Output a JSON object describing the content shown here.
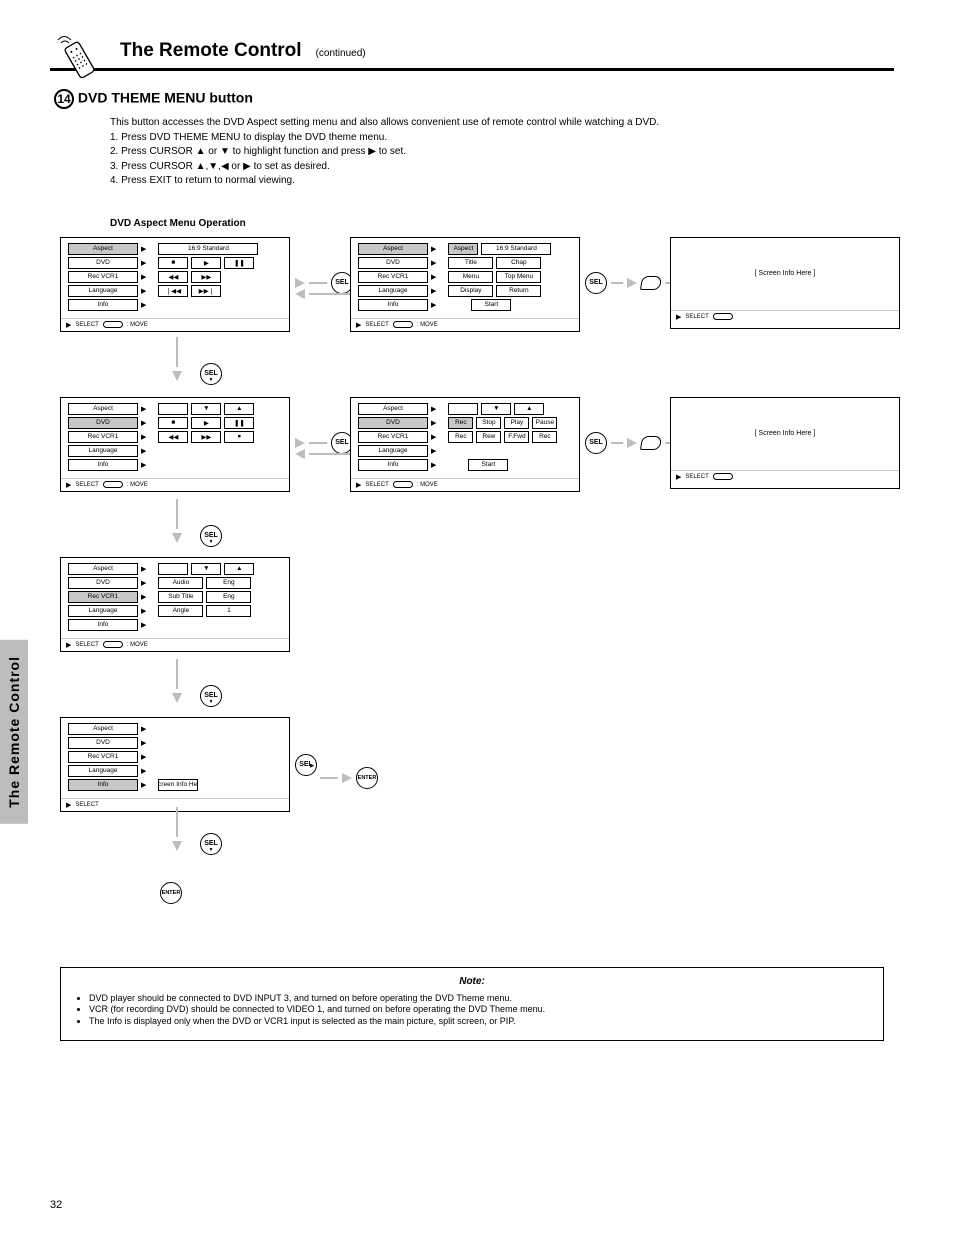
{
  "header": {
    "title": "The Remote Control",
    "subtitle": "(continued)"
  },
  "section": {
    "number": "14",
    "heading": "DVD THEME MENU button",
    "intro": "This button accesses the DVD Aspect setting menu and also allows convenient use of remote control while watching a DVD.",
    "steps": [
      "Press DVD THEME MENU to display the DVD theme menu.",
      "Press CURSOR ▲ or ▼ to highlight function and press ▶ to set.",
      "Press CURSOR ▲,▼,◀ or ▶ to set as desired.",
      "Press EXIT to return to normal viewing."
    ],
    "subhead": "DVD Aspect Menu Operation"
  },
  "osd": {
    "bar_select": "SELECT",
    "bar_move": ": MOVE",
    "menu1": {
      "left": [
        "Aspect",
        "DVD",
        "Rec VCR1",
        "Language",
        "Info"
      ],
      "right_top": [
        "16:9 Standard"
      ],
      "ctrl": [
        [
          "■",
          "▶",
          "❚❚"
        ],
        [
          "◀◀",
          "▶▶"
        ],
        [
          "❘◀◀",
          "▶▶❘"
        ]
      ]
    },
    "menu2": {
      "left": [
        "Aspect",
        "DVD",
        "Rec VCR1",
        "Language",
        "Info"
      ],
      "rows": [
        [
          "Aspect",
          "16:9 Standard"
        ],
        [
          "Title",
          "Chap"
        ],
        [
          "Menu",
          "Top Menu"
        ],
        [
          "Display",
          "Return"
        ]
      ],
      "start": "Start"
    },
    "menu3": {
      "left": [
        "Aspect",
        "DVD",
        "Rec VCR1",
        "Language",
        "Info"
      ],
      "right_top": [
        "",
        "▼",
        "▲"
      ],
      "row_dvd": [
        "■",
        "▶",
        "❚❚"
      ],
      "row_vcr": [
        "◀◀",
        "▶▶",
        "●"
      ]
    },
    "menu4": {
      "left": [
        "Aspect",
        "DVD",
        "Rec VCR1",
        "Language",
        "Info"
      ],
      "rows": [
        [
          "Aspect",
          "",
          "▼",
          "▲"
        ],
        [
          "Rec",
          "Stop",
          "Play",
          "Pause"
        ],
        [
          "Rec",
          "Rew",
          "F.Fwd",
          "Rec"
        ]
      ],
      "start": "Start"
    },
    "menu5": {
      "left": [
        "Aspect",
        "DVD",
        "Rec VCR1",
        "Language",
        "Info"
      ],
      "rows": [
        [
          "",
          "▼",
          "▲"
        ],
        [
          "Audio",
          "Eng"
        ],
        [
          "Sub Title",
          "Eng"
        ],
        [
          "Angle",
          "1"
        ]
      ]
    },
    "menu6": {
      "left": [
        "Aspect",
        "DVD",
        "Rec VCR1",
        "Language",
        "Info"
      ],
      "screen": "[ Screen Info Here ]"
    },
    "blank": {
      "screen": "[ Screen Info Here ]",
      "bar": "SELECT"
    }
  },
  "buttons": {
    "sel": "SEL",
    "enter": "ENTER"
  },
  "note": {
    "title": "Note:",
    "items": [
      "DVD player should be connected to DVD INPUT 3, and turned on before operating the DVD Theme menu.",
      "VCR (for recording DVD) should be connected to VIDEO 1, and turned on before operating the DVD Theme menu.",
      "The Info is displayed only when the DVD or VCR1 input is selected as the main picture, split screen, or PIP."
    ]
  },
  "page_number": "32"
}
